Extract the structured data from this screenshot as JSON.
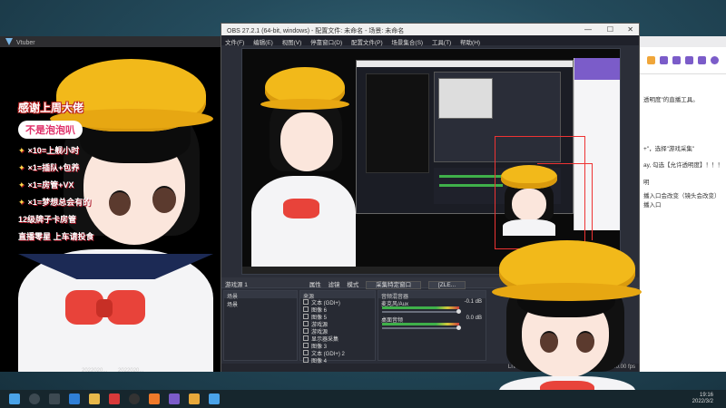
{
  "vtuber_window": {
    "title": "Vtuber",
    "overlay": {
      "title": "感谢上周大佬",
      "pill": "不是泡泡叭",
      "lines": [
        "×10=上舰小时",
        "×1=插队+包养",
        "×1=房管+VX",
        "×1=梦想总会有的",
        "12级牌子卡房管",
        "直播零星 上车请投食"
      ]
    }
  },
  "obs": {
    "title": "OBS 27.2.1 (64-bit, windows) - 配置文件: 未命名 - 场景: 未命名",
    "menu": [
      "文件(F)",
      "编辑(E)",
      "视图(V)",
      "停靠窗口(D)",
      "配置文件(P)",
      "场景集合(S)",
      "工具(T)",
      "帮助(H)"
    ],
    "dock_bar": {
      "source_label": "游戏源 1",
      "properties": "属性",
      "filters": "滤镜",
      "mode_label": "模式",
      "mode_value": "采集特定窗口",
      "window_value": "[ZLE..."
    },
    "scenes": {
      "header": "场景",
      "items": [
        "场景"
      ]
    },
    "sources": {
      "header": "来源",
      "items": [
        "文本 (GDI+)",
        "图像 6",
        "图像 5",
        "游戏源",
        "游戏源",
        "显示器采集",
        "图像 3",
        "文本 (GDI+) 2",
        "图像 4"
      ]
    },
    "mixer": {
      "header": "音频混音器",
      "channels": [
        {
          "name": "麦克风/Aux",
          "db": "-0.1 dB"
        },
        {
          "name": "桌面音频",
          "db": "0.0 dB"
        }
      ]
    },
    "status": "LIVE: 00:00:00   REC: 00:00:00   CPU: 4.9%, 60.00 fps"
  },
  "browser": {
    "lines": [
      {
        "text": "透明度\"的直播工具。",
        "red": true
      },
      {
        "text": "+\"，选择\"游戏采集\"",
        "red": false
      },
      {
        "text": "ay, 勾选【允许透明度】！！！",
        "red": false
      },
      {
        "text": "明",
        "red": false
      },
      {
        "text": "播入口会改变（镜头会改变）",
        "red": false
      },
      {
        "text": "播入口",
        "red": false
      }
    ]
  },
  "thumbs": [
    "2022020...",
    "2022020..."
  ],
  "clock": {
    "time": "19:16",
    "date": "2022/3/2"
  },
  "colors": {
    "obs_bg": "#2b2e38",
    "accent_red": "#e33333",
    "hat_yellow": "#f2b91a"
  }
}
